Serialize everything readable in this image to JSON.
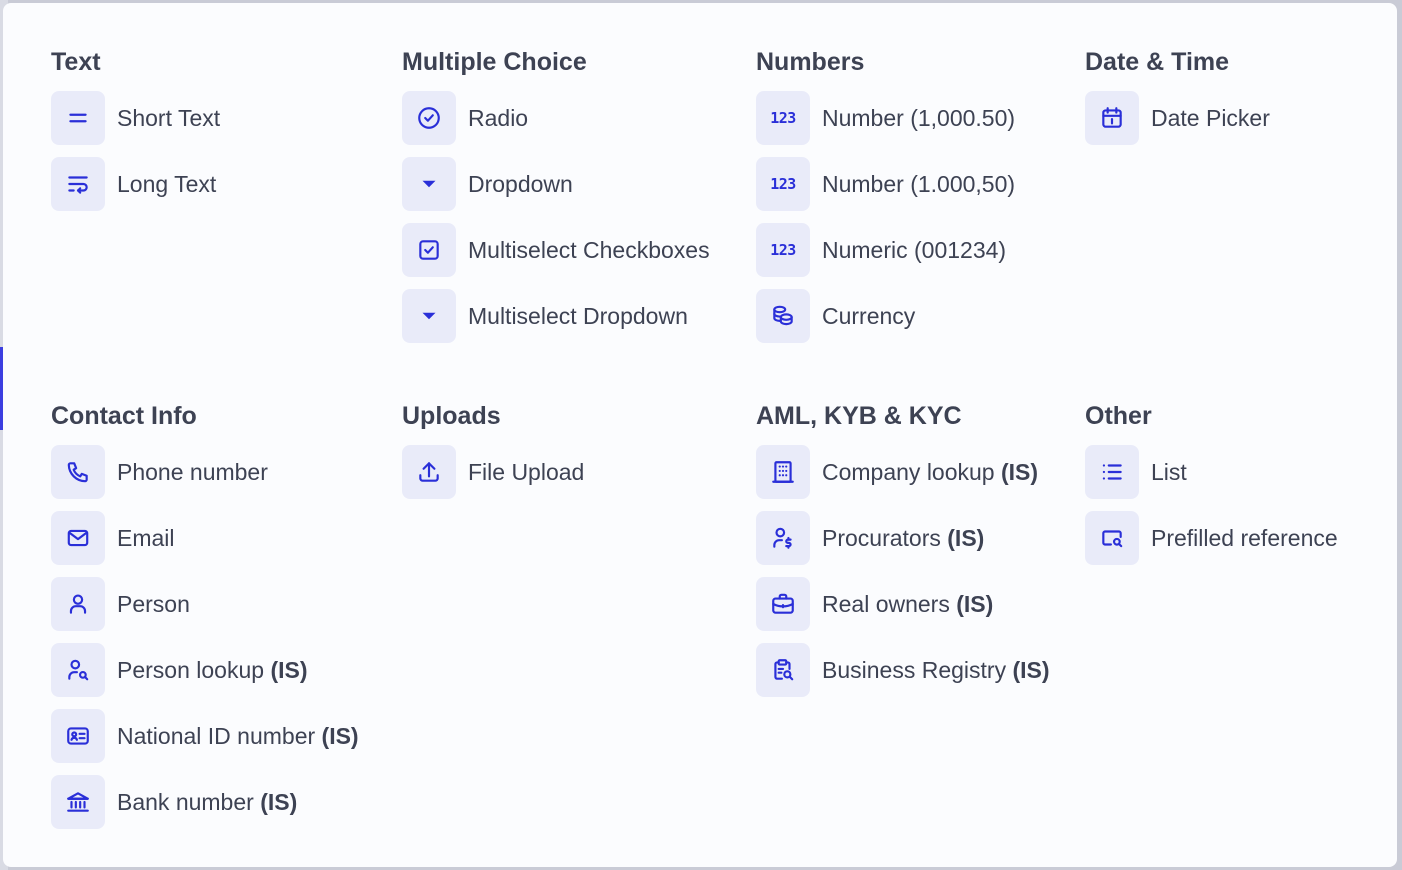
{
  "colors": {
    "accent": "#2a2fd8",
    "icon_bg": "#e9ebf9",
    "text": "#3d4253",
    "panel_bg": "#fbfcfe"
  },
  "sections": {
    "text": {
      "title": "Text",
      "items": [
        {
          "label": "Short Text",
          "icon": "equals-icon"
        },
        {
          "label": "Long Text",
          "icon": "text-wrap-icon"
        }
      ]
    },
    "multiple_choice": {
      "title": "Multiple Choice",
      "items": [
        {
          "label": "Radio",
          "icon": "check-circle-icon"
        },
        {
          "label": "Dropdown",
          "icon": "caret-down-icon"
        },
        {
          "label": "Multiselect Checkboxes",
          "icon": "checkbox-icon"
        },
        {
          "label": "Multiselect Dropdown",
          "icon": "caret-down-icon"
        }
      ]
    },
    "numbers": {
      "title": "Numbers",
      "items": [
        {
          "label": "Number (1,000.50)",
          "icon": "numbers-123-icon",
          "icon_text": "123"
        },
        {
          "label": "Number (1.000,50)",
          "icon": "numbers-123-icon",
          "icon_text": "123"
        },
        {
          "label": "Numeric (001234)",
          "icon": "numbers-123-icon",
          "icon_text": "123"
        },
        {
          "label": "Currency",
          "icon": "coins-icon"
        }
      ]
    },
    "date_time": {
      "title": "Date & Time",
      "items": [
        {
          "label": "Date Picker",
          "icon": "calendar-icon"
        }
      ]
    },
    "contact_info": {
      "title": "Contact Info",
      "items": [
        {
          "label": "Phone number",
          "icon": "phone-icon"
        },
        {
          "label": "Email",
          "icon": "mail-icon"
        },
        {
          "label": "Person",
          "icon": "person-icon"
        },
        {
          "label": "Person lookup",
          "suffix": "(IS)",
          "icon": "person-search-icon"
        },
        {
          "label": "National ID number",
          "suffix": "(IS)",
          "icon": "id-card-icon"
        },
        {
          "label": "Bank number",
          "suffix": "(IS)",
          "icon": "bank-icon"
        }
      ]
    },
    "uploads": {
      "title": "Uploads",
      "items": [
        {
          "label": "File Upload",
          "icon": "upload-icon"
        }
      ]
    },
    "aml": {
      "title": "AML, KYB & KYC",
      "items": [
        {
          "label": "Company lookup",
          "suffix": "(IS)",
          "icon": "building-icon"
        },
        {
          "label": "Procurators",
          "suffix": "(IS)",
          "icon": "person-dollar-icon"
        },
        {
          "label": "Real owners",
          "suffix": "(IS)",
          "icon": "briefcase-icon"
        },
        {
          "label": "Business Registry",
          "suffix": "(IS)",
          "icon": "clipboard-search-icon"
        }
      ]
    },
    "other": {
      "title": "Other",
      "items": [
        {
          "label": "List",
          "icon": "list-icon"
        },
        {
          "label": "Prefilled reference",
          "icon": "window-search-icon"
        }
      ]
    }
  }
}
